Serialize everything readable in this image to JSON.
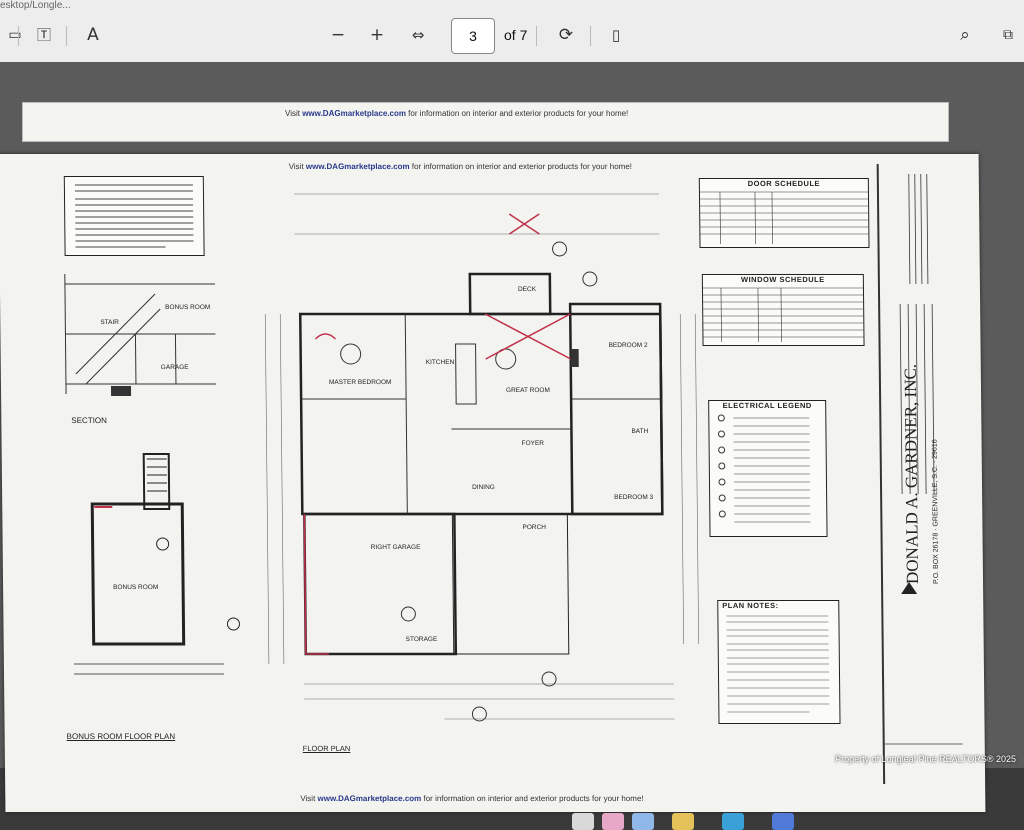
{
  "window": {
    "path_text": "esktop/Longle..."
  },
  "toolbar": {
    "icons": [
      "sidebar-icon",
      "text-select-icon",
      "read-aloud-icon",
      "zoom-out-icon",
      "zoom-in-icon",
      "fit-width-icon",
      "rotate-icon",
      "page-view-icon",
      "search-icon",
      "fullscreen-icon"
    ],
    "page_current": "3",
    "page_total_label": "of 7",
    "zoom_out": "−",
    "zoom_in": "+"
  },
  "document": {
    "banner_top_prefix": "Visit ",
    "banner_link": "www.DAGmarketplace.com",
    "banner_suffix": " for information on interior and exterior products for your home!",
    "door_schedule_title": "DOOR SCHEDULE",
    "window_schedule_title": "WINDOW SCHEDULE",
    "electrical_legend_title": "ELECTRICAL LEGEND",
    "plan_notes_title": "PLAN NOTES:",
    "section_label": "SECTION",
    "bonus_room_floor_plan": "BONUS ROOM FLOOR PLAN",
    "floor_plan_label": "FLOOR PLAN",
    "rooms": {
      "bonus_room": "BONUS ROOM",
      "stair": "STAIR",
      "garage": "GARAGE",
      "master_bedroom": "MASTER BEDROOM",
      "kitchen": "KITCHEN",
      "great_room": "GREAT ROOM",
      "bedroom2": "BEDROOM 2",
      "bedroom3": "BEDROOM 3",
      "bath": "BATH",
      "foyer": "FOYER",
      "dining": "DINING",
      "porch": "PORCH",
      "deck": "DECK",
      "right_garage": "RIGHT GARAGE",
      "storage": "STORAGE"
    },
    "company_name": "DONALD A. GARDNER, INC.",
    "company_address": "P.O. BOX 26178 · GREENVILLE, S.C. · 29616"
  },
  "watermark": "Property of Longleaf Pine REALTORS® 2025",
  "colors": {
    "toolbar_bg": "#ededed",
    "paper": "#f3f3f0",
    "link_blue": "#2a3a8a",
    "markup_red": "#c0304a"
  }
}
